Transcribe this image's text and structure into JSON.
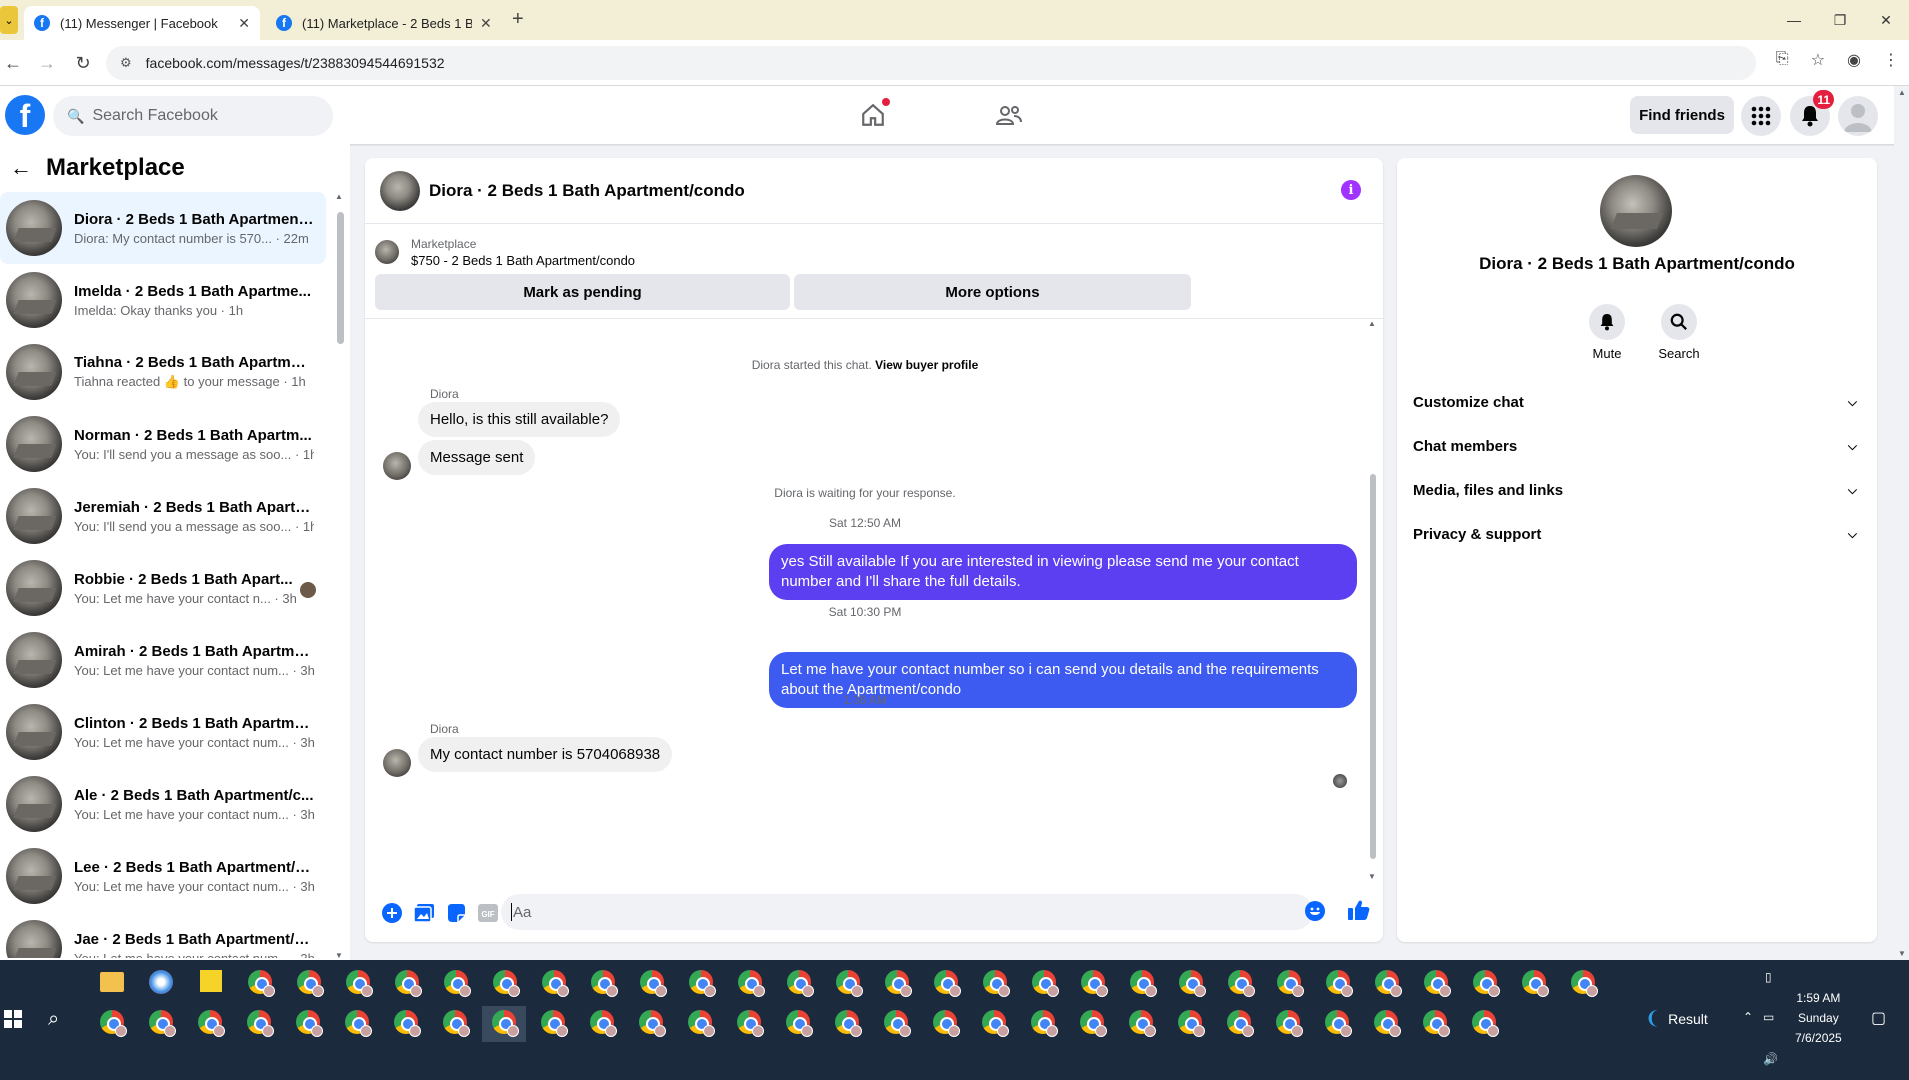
{
  "browser": {
    "tabs": [
      {
        "title": "(11) Messenger | Facebook",
        "active": true
      },
      {
        "title": "(11) Marketplace - 2 Beds 1 Bat",
        "active": false
      }
    ],
    "url": "facebook.com/messages/t/23883094544691532"
  },
  "header": {
    "search_placeholder": "Search Facebook",
    "find_friends": "Find friends",
    "notification_count": "11",
    "brand_color": "#1877f2"
  },
  "sidebar": {
    "title": "Marketplace",
    "conversations": [
      {
        "name": "Diora · 2 Beds 1 Bath Apartment...",
        "preview": "Diora: My contact number is 570... · 22m",
        "active": true
      },
      {
        "name": "Imelda · 2 Beds 1 Bath Apartme...",
        "preview": "Imelda: Okay thanks you · 1h"
      },
      {
        "name": "Tiahna · 2 Beds 1 Bath Apartmen...",
        "preview": "Tiahna reacted 👍 to your message · 1h"
      },
      {
        "name": "Norman · 2 Beds 1 Bath Apartm...",
        "preview": "You: I'll send you a message as soo... · 1h"
      },
      {
        "name": "Jeremiah · 2 Beds 1 Bath Apartm...",
        "preview": "You: I'll send you a message as soo... · 1h"
      },
      {
        "name": "Robbie · 2 Beds 1 Bath Apart...",
        "preview": "You: Let me have your contact n... · 3h",
        "seen": true
      },
      {
        "name": "Amirah · 2 Beds 1 Bath Apartme...",
        "preview": "You: Let me have your contact num... · 3h"
      },
      {
        "name": "Clinton · 2 Beds 1 Bath Apartme...",
        "preview": "You: Let me have your contact num... · 3h"
      },
      {
        "name": "Ale · 2 Beds 1 Bath Apartment/c...",
        "preview": "You: Let me have your contact num... · 3h"
      },
      {
        "name": "Lee · 2 Beds 1 Bath Apartment/c...",
        "preview": "You: Let me have your contact num... · 3h"
      },
      {
        "name": "Jae · 2 Beds 1 Bath Apartment/c...",
        "preview": "You: Let me have your contact num... · 3h"
      }
    ]
  },
  "chat": {
    "title": "Diora · 2 Beds 1 Bath Apartment/condo",
    "listing_label": "Marketplace",
    "listing_price": "$750 - 2 Beds 1 Bath Apartment/condo",
    "mark_pending": "Mark as pending",
    "more_options": "More options",
    "started_text": "Diora started this chat.",
    "view_profile": "View buyer profile",
    "sender1": "Diora",
    "msg1": "Hello, is this still available?",
    "msg2": "Message sent",
    "waiting": "Diora is waiting for your response.",
    "time1": "Sat 12:50 AM",
    "out1": "yes Still available If you are interested in viewing please send me your contact number and I'll share the full details.",
    "time2": "Sat 10:30 PM",
    "out2": "Let me have your contact number so i can send you details and the requirements about the Apartment/condo",
    "time3": "1:36 AM",
    "sender2": "Diora",
    "msg3": "My contact number is 5704068938",
    "composer_placeholder": "Aa",
    "outgoing_color": "#5b3ff0",
    "info_color": "#a033ff"
  },
  "details": {
    "name": "Diora · 2 Beds 1 Bath Apartment/condo",
    "mute": "Mute",
    "search": "Search",
    "sections": [
      "Customize chat",
      "Chat members",
      "Media, files and links",
      "Privacy & support"
    ]
  },
  "taskbar": {
    "result_label": "Result",
    "time": "1:59 AM",
    "day": "Sunday",
    "date": "7/6/2025"
  }
}
